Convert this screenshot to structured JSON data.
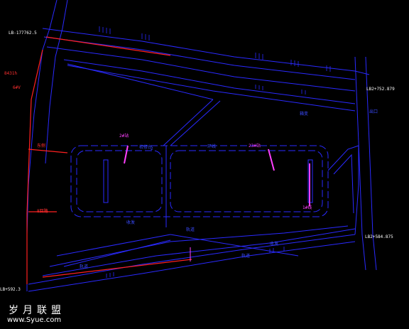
{
  "drawing": {
    "background": "#000000",
    "line_color": "#2a2aff",
    "boundary_color": "#ff2020",
    "highlight_color": "#ff40ff",
    "labels": {
      "corner_top_left": "LB-177762.5",
      "left_station": "8431h",
      "left_sub": "6#V",
      "left_mid": "东侧",
      "left_lower": "8回路",
      "top_right_road": "LB2+752.879",
      "right_note": "出口",
      "right_small": "箱变",
      "center_tag_left": "2#站",
      "center_tag_mid": "检修台",
      "center_tag_right": "23#站",
      "center_road": "环线",
      "track_1": "收发",
      "track_2": "2",
      "track_3": "轨道",
      "bottom_road_1": "轨道",
      "bottom_road_2": "轨道",
      "right_lower": "LB2+584.875",
      "bottom_left": "LB+592.3",
      "right_marker": "1#线",
      "bottom_center": "收发"
    }
  },
  "watermark": {
    "cn": "岁月联盟",
    "url": "www.Syue.com"
  }
}
